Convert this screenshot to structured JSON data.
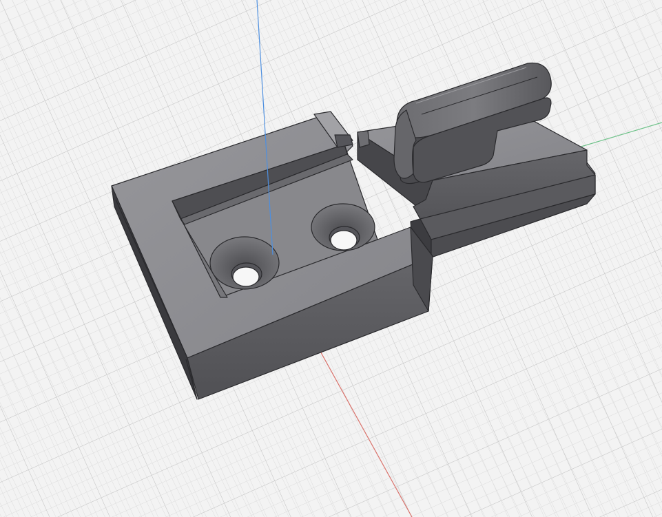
{
  "viewport": {
    "background": "#f3f3f3",
    "grid": {
      "visible": true,
      "minor_color": "#dadada",
      "major_color": "#c4c4c4"
    },
    "axes": {
      "x_color": "#d9726b",
      "y_color": "#6fc28a",
      "z_color": "#4d8fe0"
    }
  },
  "model": {
    "parts": [
      "hasp-plate",
      "latch-block"
    ],
    "colors": {
      "top": "#8f8f93",
      "front": "#5e5e62",
      "side": "#3e3e42",
      "edge": "#2a2a2d",
      "highlight": "#a8a8ac"
    }
  }
}
